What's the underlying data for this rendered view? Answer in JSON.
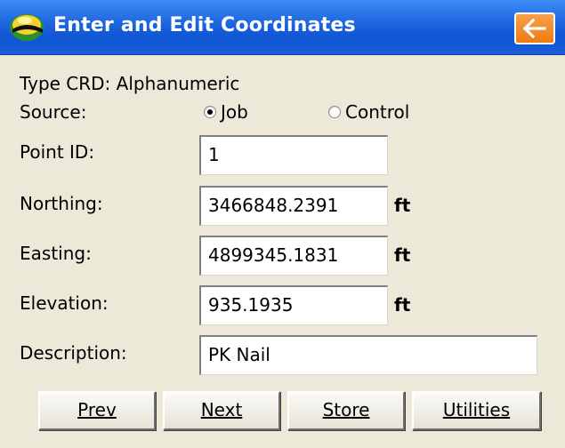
{
  "window": {
    "title": "Enter and Edit Coordinates",
    "back_icon": "arrow-left-icon",
    "logo_icon": "survey-logo-icon"
  },
  "form": {
    "type_label": "Type CRD: Alphanumeric",
    "source_label": "Source:",
    "source_options": [
      {
        "label": "Job",
        "selected": true
      },
      {
        "label": "Control",
        "selected": false
      }
    ],
    "point_id": {
      "label": "Point ID:",
      "value": "1"
    },
    "northing": {
      "label": "Northing:",
      "value": "3466848.2391",
      "unit": "ft"
    },
    "easting": {
      "label": "Easting:",
      "value": "4899345.1831",
      "unit": "ft"
    },
    "elevation": {
      "label": "Elevation:",
      "value": "935.1935",
      "unit": "ft"
    },
    "description": {
      "label": "Description:",
      "value": "PK Nail"
    }
  },
  "buttons": {
    "prev": "Prev",
    "next": "Next",
    "store": "Store",
    "utilities": "Utilities"
  },
  "colors": {
    "titlebar": "#1c63de",
    "back_button": "#ee7b15",
    "background": "#ece9d8"
  }
}
